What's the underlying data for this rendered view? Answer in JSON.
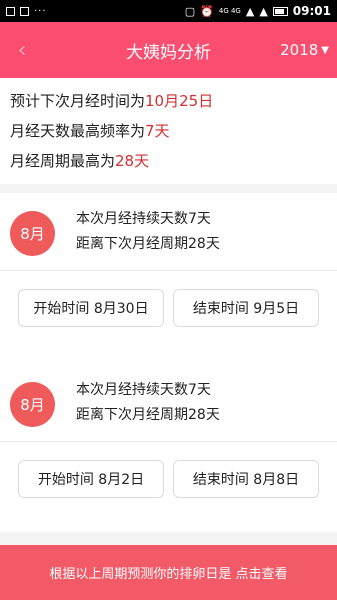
{
  "status_bar": {
    "left_icons": [
      "image-icon",
      "chart-icon",
      "more-dots-icon"
    ],
    "dots": "···",
    "network": "4G 4G",
    "time": "09:01"
  },
  "header": {
    "back_icon": "chevron-left-icon",
    "back": "‹",
    "title": "大姨妈分析",
    "year": "2018",
    "year_caret": "▼"
  },
  "summary": {
    "lines": [
      {
        "prefix": "预计下次月经时间为",
        "value": "10月25日"
      },
      {
        "prefix": "月经天数最高频率为",
        "value": "7天"
      },
      {
        "prefix": "月经周期最高为",
        "value": "28天"
      }
    ]
  },
  "cycles": [
    {
      "month": "8月",
      "duration_text": "本次月经持续天数7天",
      "cycle_text": "距离下次月经周期28天",
      "start_label": "开始时间 8月30日",
      "end_label": "结束时间 9月5日"
    },
    {
      "month": "8月",
      "duration_text": "本次月经持续天数7天",
      "cycle_text": "距离下次月经周期28天",
      "start_label": "开始时间 8月2日",
      "end_label": "结束时间 8月8日"
    }
  ],
  "footer": {
    "text": "根据以上周期预测你的排卵日是 点击查看"
  },
  "colors": {
    "header": "#fb4d6f",
    "highlight": "#d32f2f",
    "month_circle": "#ef5b5b",
    "footer": "#f25a67"
  }
}
